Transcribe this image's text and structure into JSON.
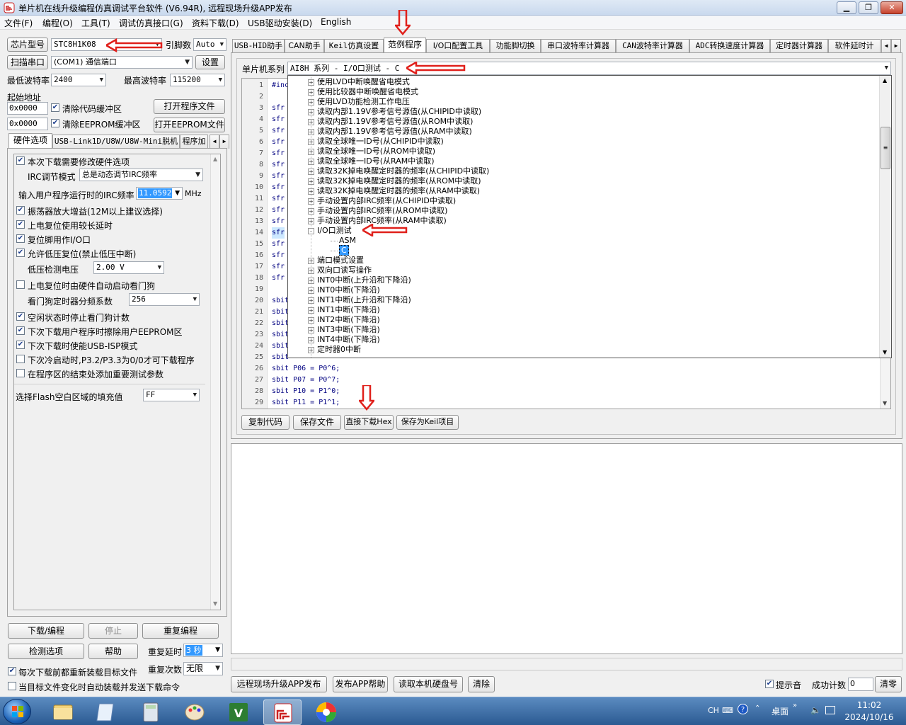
{
  "window": {
    "title": "单片机在线升级编程仿真调试平台软件 (V6.94R), 远程现场升级APP发布"
  },
  "menu": [
    "文件(F)",
    "编程(O)",
    "工具(T)",
    "调试仿真接口(G)",
    "资料下载(D)",
    "USB驱动安装(D)",
    "English"
  ],
  "left": {
    "chip_btn": "芯片型号",
    "chip_value": "STC8H1K08",
    "pin_label": "引脚数",
    "pin_value": "Auto",
    "scan_btn": "扫描串口",
    "port_value": "(COM1) 通信端口",
    "settings_btn": "设置",
    "min_baud_label": "最低波特率",
    "min_baud": "2400",
    "max_baud_label": "最高波特率",
    "max_baud": "115200",
    "start_addr_label": "起始地址",
    "addr1": "0x0000",
    "clear_code": "清除代码缓冲区",
    "open_prog": "打开程序文件",
    "addr2": "0x0000",
    "clear_eeprom": "清除EEPROM缓冲区",
    "open_eeprom": "打开EEPROM文件",
    "tabs": [
      "硬件选项",
      "USB-Link1D/U8W/U8W-Mini脱机",
      "程序加"
    ],
    "opt_modify_hw": "本次下载需要修改硬件选项",
    "irc_mode_label": "IRC调节模式",
    "irc_mode_value": "总是动态调节IRC频率",
    "irc_freq_label": "输入用户程序运行时的IRC频率",
    "irc_freq_value": "11.0592",
    "irc_unit": "MHz",
    "opt_osc": "振荡器放大增益(12M以上建议选择)",
    "opt_por": "上电复位使用较长延时",
    "opt_reset_io": "复位脚用作I/O口",
    "opt_lvr": "允许低压复位(禁止低压中断)",
    "lv_label": "低压检测电压",
    "lv_value": "2.00 V",
    "opt_wdt_auto": "上电复位时由硬件自动启动看门狗",
    "wdt_div_label": "看门狗定时器分频系数",
    "wdt_div_value": "256",
    "opt_idle_wdt": "空闲状态时停止看门狗计数",
    "opt_erase_eeprom": "下次下载用户程序时擦除用户EEPROM区",
    "opt_usb_isp": "下次下载时使能USB-ISP模式",
    "opt_p32p33": "下次冷启动时,P3.2/P3.3为0/0才可下载程序",
    "opt_test_param": "在程序区的结束处添加重要测试参数",
    "flash_fill_label": "选择Flash空白区域的填充值",
    "flash_fill_value": "FF",
    "download_btn": "下载/编程",
    "stop_btn": "停止",
    "reprogram_btn": "重复编程",
    "check_btn": "检测选项",
    "help_btn": "帮助",
    "repeat_delay_label": "重复延时",
    "repeat_delay_value": "3 秒",
    "repeat_count_label": "重复次数",
    "repeat_count_value": "无限",
    "reload_each": "每次下载前都重新装载目标文件",
    "auto_reload": "当目标文件变化时自动装载并发送下载命令"
  },
  "right": {
    "tabs": [
      "USB-HID助手",
      "CAN助手",
      "Keil仿真设置",
      "范例程序",
      "I/O口配置工具",
      "功能脚切换",
      "串口波特率计算器",
      "CAN波特率计算器",
      "ADC转换速度计算器",
      "定时器计算器",
      "软件延时计"
    ],
    "series_label": "单片机系列",
    "series_value": "AI8H 系列 - I/O口测试 - C",
    "code_lines": [
      {
        "n": "1",
        "t": "#inc"
      },
      {
        "n": "2",
        "t": ""
      },
      {
        "n": "3",
        "t": "sfr"
      },
      {
        "n": "4",
        "t": "sfr"
      },
      {
        "n": "5",
        "t": "sfr"
      },
      {
        "n": "6",
        "t": "sfr"
      },
      {
        "n": "7",
        "t": "sfr"
      },
      {
        "n": "8",
        "t": "sfr"
      },
      {
        "n": "9",
        "t": "sfr"
      },
      {
        "n": "10",
        "t": "sfr"
      },
      {
        "n": "11",
        "t": "sfr"
      },
      {
        "n": "12",
        "t": "sfr"
      },
      {
        "n": "13",
        "t": "sfr"
      },
      {
        "n": "14",
        "t": "sfr"
      },
      {
        "n": "15",
        "t": "sfr"
      },
      {
        "n": "16",
        "t": "sfr"
      },
      {
        "n": "17",
        "t": "sfr"
      },
      {
        "n": "18",
        "t": "sfr"
      },
      {
        "n": "19",
        "t": ""
      },
      {
        "n": "20",
        "t": "sbit"
      },
      {
        "n": "21",
        "t": "sbit"
      },
      {
        "n": "22",
        "t": "sbit"
      },
      {
        "n": "23",
        "t": "sbit"
      },
      {
        "n": "24",
        "t": "sbit"
      },
      {
        "n": "25",
        "t": "sbit"
      },
      {
        "n": "26",
        "t": "sbit P06 = P0^6;"
      },
      {
        "n": "27",
        "t": "sbit P07 = P0^7;"
      },
      {
        "n": "28",
        "t": "sbit P10 = P1^0;"
      },
      {
        "n": "29",
        "t": "sbit P11 = P1^1;"
      }
    ],
    "tree": [
      {
        "t": "使用LVD中断唤醒省电模式",
        "lvl": 0,
        "pm": "+"
      },
      {
        "t": "使用比较器中断唤醒省电模式",
        "lvl": 0,
        "pm": "+"
      },
      {
        "t": "使用LVD功能检测工作电压",
        "lvl": 0,
        "pm": "+"
      },
      {
        "t": "读取内部1.19V参考信号源值(从CHIPID中读取)",
        "lvl": 0,
        "pm": "+"
      },
      {
        "t": "读取内部1.19V参考信号源值(从ROM中读取)",
        "lvl": 0,
        "pm": "+"
      },
      {
        "t": "读取内部1.19V参考信号源值(从RAM中读取)",
        "lvl": 0,
        "pm": "+"
      },
      {
        "t": "读取全球唯一ID号(从CHIPID中读取)",
        "lvl": 0,
        "pm": "+"
      },
      {
        "t": "读取全球唯一ID号(从ROM中读取)",
        "lvl": 0,
        "pm": "+"
      },
      {
        "t": "读取全球唯一ID号(从RAM中读取)",
        "lvl": 0,
        "pm": "+"
      },
      {
        "t": "读取32K掉电唤醒定时器的频率(从CHIPID中读取)",
        "lvl": 0,
        "pm": "+"
      },
      {
        "t": "读取32K掉电唤醒定时器的频率(从ROM中读取)",
        "lvl": 0,
        "pm": "+"
      },
      {
        "t": "读取32K掉电唤醒定时器的频率(从RAM中读取)",
        "lvl": 0,
        "pm": "+"
      },
      {
        "t": "手动设置内部IRC频率(从CHIPID中读取)",
        "lvl": 0,
        "pm": "+"
      },
      {
        "t": "手动设置内部IRC频率(从ROM中读取)",
        "lvl": 0,
        "pm": "+"
      },
      {
        "t": "手动设置内部IRC频率(从RAM中读取)",
        "lvl": 0,
        "pm": "+"
      },
      {
        "t": "I/O口测试",
        "lvl": 0,
        "pm": "-"
      },
      {
        "t": "ASM",
        "lvl": 1,
        "pm": ""
      },
      {
        "t": "C",
        "lvl": 1,
        "pm": "",
        "sel": true
      },
      {
        "t": "端口模式设置",
        "lvl": 0,
        "pm": "+"
      },
      {
        "t": "双向口读写操作",
        "lvl": 0,
        "pm": "+"
      },
      {
        "t": "INT0中断(上升沿和下降沿)",
        "lvl": 0,
        "pm": "+"
      },
      {
        "t": "INT0中断(下降沿)",
        "lvl": 0,
        "pm": "+"
      },
      {
        "t": "INT1中断(上升沿和下降沿)",
        "lvl": 0,
        "pm": "+"
      },
      {
        "t": "INT1中断(下降沿)",
        "lvl": 0,
        "pm": "+"
      },
      {
        "t": "INT2中断(下降沿)",
        "lvl": 0,
        "pm": "+"
      },
      {
        "t": "INT3中断(下降沿)",
        "lvl": 0,
        "pm": "+"
      },
      {
        "t": "INT4中断(下降沿)",
        "lvl": 0,
        "pm": "+"
      },
      {
        "t": "定时器0中断",
        "lvl": 0,
        "pm": "+"
      }
    ],
    "copy_btn": "复制代码",
    "save_btn": "保存文件",
    "download_hex_btn": "直接下载Hex",
    "save_keil_btn": "保存为Keil项目",
    "bottom_btns": [
      "远程现场升级APP发布",
      "发布APP帮助",
      "读取本机硬盘号",
      "清除"
    ],
    "beep_label": "提示音",
    "success_label": "成功计数",
    "success_value": "0",
    "clear_btn": "清零"
  },
  "taskbar": {
    "lang": "CH",
    "desktop": "桌面",
    "time": "11:02",
    "date": "2024/10/16"
  },
  "colors": {
    "accent_red": "#e0201b",
    "select_blue": "#3399ff",
    "code_blue": "#000080"
  }
}
